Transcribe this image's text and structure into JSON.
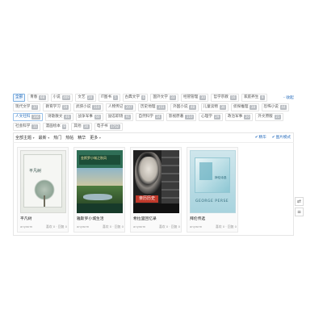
{
  "categories": {
    "rows": [
      [
        {
          "label": "全部",
          "count": "",
          "state": "active"
        },
        {
          "label": "青春",
          "count": "68",
          "state": ""
        },
        {
          "label": "小说",
          "count": "409",
          "state": ""
        },
        {
          "label": "文艺",
          "count": "20",
          "state": ""
        },
        {
          "label": "IT图书",
          "count": "5",
          "state": ""
        },
        {
          "label": "古典文学",
          "count": "6",
          "state": ""
        },
        {
          "label": "国外文学",
          "count": "33",
          "state": ""
        },
        {
          "label": "经管管理",
          "count": "30",
          "state": ""
        },
        {
          "label": "哲学宗教",
          "count": "16",
          "state": ""
        },
        {
          "label": "家庭养生",
          "count": "9",
          "state": ""
        }
      ],
      [
        {
          "label": "现代文学",
          "count": "37",
          "state": ""
        },
        {
          "label": "教育学习",
          "count": "19",
          "state": ""
        },
        {
          "label": "武侠小说",
          "count": "110",
          "state": ""
        },
        {
          "label": "人物传记",
          "count": "207",
          "state": ""
        },
        {
          "label": "历史地理",
          "count": "151",
          "state": ""
        },
        {
          "label": "外国小说",
          "count": "48",
          "state": ""
        },
        {
          "label": "儿童读物",
          "count": "30",
          "state": ""
        },
        {
          "label": "侦探推理",
          "count": "38",
          "state": ""
        },
        {
          "label": "恐怖小说",
          "count": "44",
          "state": ""
        }
      ],
      [
        {
          "label": "人文社科",
          "count": "166",
          "state": "highlight"
        },
        {
          "label": "诗歌散文",
          "count": "46",
          "state": ""
        },
        {
          "label": "战争军事",
          "count": "60",
          "state": ""
        },
        {
          "label": "励志职场",
          "count": "91",
          "state": ""
        },
        {
          "label": "自然科学",
          "count": "24",
          "state": ""
        },
        {
          "label": "影视原著",
          "count": "110",
          "state": ""
        },
        {
          "label": "心理学",
          "count": "29",
          "state": ""
        },
        {
          "label": "政治军事",
          "count": "20",
          "state": ""
        },
        {
          "label": "外文原版",
          "count": "21",
          "state": ""
        }
      ],
      [
        {
          "label": "社会科学",
          "count": "11",
          "state": ""
        },
        {
          "label": "漫画绘本",
          "count": "9",
          "state": ""
        },
        {
          "label": "其他",
          "count": "30",
          "state": ""
        },
        {
          "label": "电子书",
          "count": "1752",
          "state": ""
        }
      ]
    ],
    "collapse_label": "- 收起"
  },
  "filter": {
    "all_topics": "全部主题",
    "sort_label": "最新",
    "sort_options": [
      "热门",
      "热帖",
      "精华",
      "更多"
    ],
    "view_list": "精华",
    "view_grid": "图片模式"
  },
  "books": [
    {
      "title": "平凡树",
      "author": "anywrm",
      "meta": "喜欢 0 · 回复 0",
      "cover_text": "平凡树"
    },
    {
      "title": "雅斯罗小城生活",
      "author": "anywrm",
      "meta": "喜欢 0 · 回复 0",
      "cover_text": "金斯罗小城之秋风"
    },
    {
      "title": "希拉里回忆录",
      "author": "anywrm",
      "meta": "喜欢 0 · 回复 0",
      "cover_text": "亲历历史"
    },
    {
      "title": "拜伦传选",
      "author": "anywrm",
      "meta": "喜欢 0 · 回复 0",
      "cover_text": "GEORGE PERSE",
      "cover_sub": "拜伦诗选"
    }
  ],
  "side_buttons": {
    "share_icon": "share-icon",
    "list_icon": "list-icon"
  }
}
